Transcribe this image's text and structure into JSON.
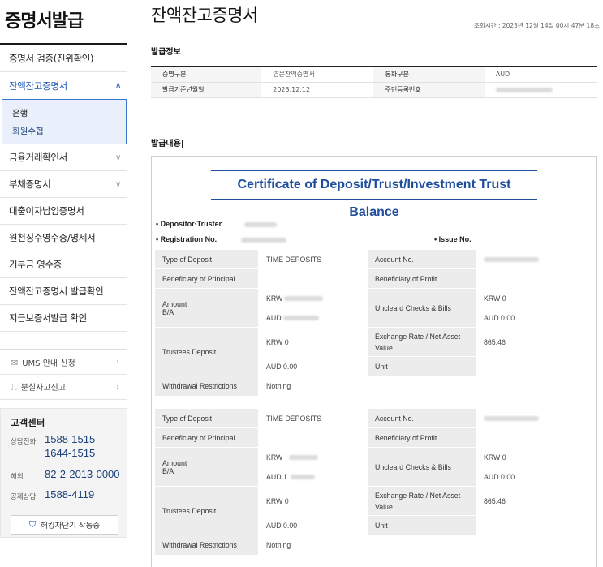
{
  "sidebar": {
    "title": "증명서발급",
    "menu": [
      {
        "label": "증명서 검증(진위확인)",
        "chev": ""
      },
      {
        "label": "잔액잔고증명서",
        "chev": "∧"
      },
      {
        "label": "금융거래확인서",
        "chev": "∨"
      },
      {
        "label": "부채증명서",
        "chev": "∨"
      },
      {
        "label": "대출이자납입증명서",
        "chev": ""
      },
      {
        "label": "원천징수영수증/명세서",
        "chev": ""
      },
      {
        "label": "기부금 영수증",
        "chev": ""
      },
      {
        "label": "잔액잔고증명서 발급확인",
        "chev": ""
      },
      {
        "label": "지급보증서발급 확인",
        "chev": ""
      }
    ],
    "submenu": [
      "은행",
      "회원수협"
    ],
    "services": [
      {
        "icon": "✉",
        "label": "UMS 안내 신청"
      },
      {
        "icon": "⎍",
        "label": "분실사고신고"
      }
    ],
    "customer_center": {
      "title": "고객센터",
      "rows": [
        {
          "label": "상담전화",
          "numbers": [
            "1588-1515",
            "1644-1515"
          ]
        },
        {
          "label": "해외",
          "numbers": [
            "82-2-2013-0000"
          ]
        },
        {
          "label": "공제상담",
          "numbers": [
            "1588-4119"
          ]
        }
      ],
      "button": "해킹차단기 작동중"
    }
  },
  "main": {
    "title": "잔액잔고증명서",
    "timestamp": "조회시간 : 2023년 12월 14일 00시 47분 18초",
    "issue_info": {
      "section": "발급정보",
      "rows": [
        [
          {
            "h": "증명구분",
            "v": "영문잔액증명서"
          },
          {
            "h": "통화구분",
            "v": "AUD"
          }
        ],
        [
          {
            "h": "발급기준년월일",
            "v": "2023.12.12"
          },
          {
            "h": "주민등록번호",
            "v": ""
          }
        ]
      ]
    },
    "issue_content": {
      "section": "발급내용"
    },
    "certificate": {
      "title": "Certificate of Deposit/Trust/Investment Trust Balance",
      "depositor_label": "• Depositor·Truster",
      "registration_label": "• Registration No.",
      "issue_no_label": "• Issue No.",
      "blocks": [
        {
          "type_of_deposit_label": "Type of Deposit",
          "type_of_deposit": "TIME DEPOSITS",
          "account_no_label": "Account No.",
          "beneficiary_principal_label": "Beneficiary of Principal",
          "beneficiary_profit_label": "Beneficiary of Profit",
          "amount_label": "Amount",
          "ba_label": "B/A",
          "amount_krw": "KRW",
          "amount_aud": "AUD",
          "uncleared_label": "Uncleard Checks & Bills",
          "uncleared_krw": "KRW 0",
          "uncleared_aud": "AUD 0.00",
          "trustees_label": "Trustees Deposit",
          "trustees_krw": "KRW 0",
          "trustees_aud": "AUD 0.00",
          "exchange_label": "Exchange Rate / Net Asset Value",
          "exchange": "865.46",
          "unit_label": "Unit",
          "withdrawal_label": "Withdrawal Restrictions",
          "withdrawal": "Nothing"
        },
        {
          "type_of_deposit_label": "Type of Deposit",
          "type_of_deposit": "TIME DEPOSITS",
          "account_no_label": "Account No.",
          "beneficiary_principal_label": "Beneficiary of Principal",
          "beneficiary_profit_label": "Beneficiary of Profit",
          "amount_label": "Amount",
          "ba_label": "B/A",
          "amount_krw": "KRW",
          "amount_aud": "AUD 1",
          "uncleared_label": "Uncleard Checks & Bills",
          "uncleared_krw": "KRW 0",
          "uncleared_aud": "AUD 0.00",
          "trustees_label": "Trustees Deposit",
          "trustees_krw": "KRW 0",
          "trustees_aud": "AUD 0.00",
          "exchange_label": "Exchange Rate / Net Asset Value",
          "exchange": "865.46",
          "unit_label": "Unit",
          "withdrawal_label": "Withdrawal Restrictions",
          "withdrawal": "Nothing"
        }
      ]
    }
  }
}
